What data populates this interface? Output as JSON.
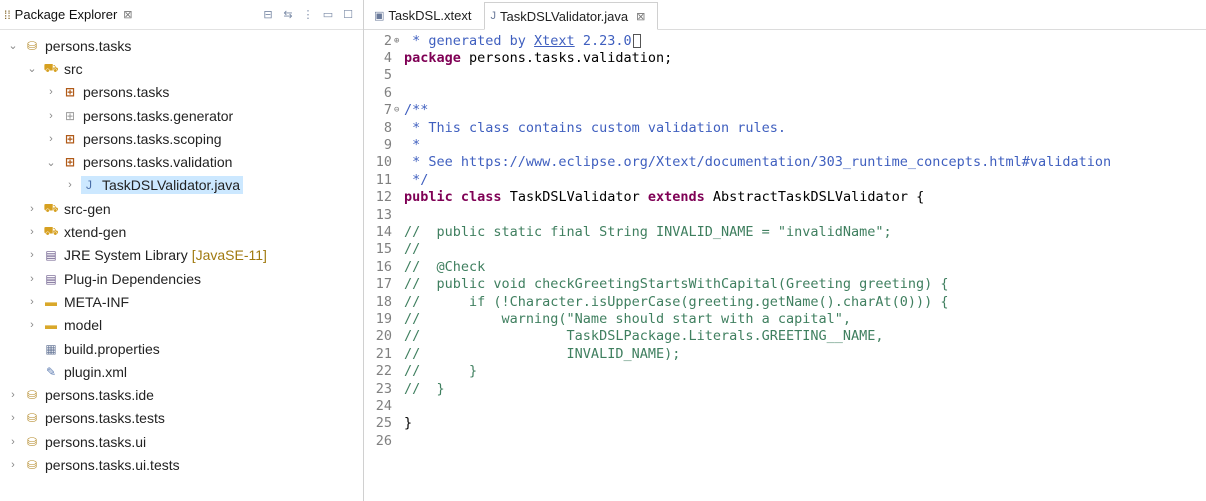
{
  "explorer": {
    "title": "Package Explorer",
    "close_glyph": "⊠",
    "toolbar": [
      "collapse-all-icon",
      "link-with-editor-icon",
      "view-menu-icon",
      "minimize-icon",
      "maximize-icon"
    ],
    "tree": [
      {
        "depth": 0,
        "twisty": "open",
        "icon": "project",
        "label": "persons.tasks"
      },
      {
        "depth": 1,
        "twisty": "open",
        "icon": "srcfolder",
        "label": "src"
      },
      {
        "depth": 2,
        "twisty": "closed",
        "icon": "package",
        "label": "persons.tasks"
      },
      {
        "depth": 2,
        "twisty": "closed",
        "icon": "emptypkg",
        "label": "persons.tasks.generator"
      },
      {
        "depth": 2,
        "twisty": "closed",
        "icon": "package",
        "label": "persons.tasks.scoping"
      },
      {
        "depth": 2,
        "twisty": "open",
        "icon": "package",
        "label": "persons.tasks.validation"
      },
      {
        "depth": 3,
        "twisty": "closed",
        "icon": "java",
        "label": "TaskDSLValidator.java",
        "selected": true
      },
      {
        "depth": 1,
        "twisty": "closed",
        "icon": "srcfolder",
        "label": "src-gen"
      },
      {
        "depth": 1,
        "twisty": "closed",
        "icon": "srcfolder",
        "label": "xtend-gen"
      },
      {
        "depth": 1,
        "twisty": "closed",
        "icon": "lib",
        "label": "JRE System Library",
        "decoration": "[JavaSE-11]"
      },
      {
        "depth": 1,
        "twisty": "closed",
        "icon": "lib",
        "label": "Plug-in Dependencies"
      },
      {
        "depth": 1,
        "twisty": "closed",
        "icon": "folder",
        "label": "META-INF"
      },
      {
        "depth": 1,
        "twisty": "closed",
        "icon": "folder",
        "label": "model"
      },
      {
        "depth": 1,
        "twisty": "none",
        "icon": "props",
        "label": "build.properties"
      },
      {
        "depth": 1,
        "twisty": "none",
        "icon": "xml",
        "label": "plugin.xml"
      },
      {
        "depth": 0,
        "twisty": "closed",
        "icon": "project",
        "label": "persons.tasks.ide"
      },
      {
        "depth": 0,
        "twisty": "closed",
        "icon": "project",
        "label": "persons.tasks.tests"
      },
      {
        "depth": 0,
        "twisty": "closed",
        "icon": "project",
        "label": "persons.tasks.ui"
      },
      {
        "depth": 0,
        "twisty": "closed",
        "icon": "project",
        "label": "persons.tasks.ui.tests"
      }
    ]
  },
  "editor": {
    "tabs": [
      {
        "label": "TaskDSL.xtext",
        "icon": "xtext-file-icon",
        "active": false
      },
      {
        "label": "TaskDSLValidator.java",
        "icon": "java-file-icon",
        "active": true,
        "close_glyph": "⊠"
      }
    ],
    "lines": [
      {
        "n": "2",
        "fold": "⊕",
        "caret": true,
        "tokens": [
          {
            "t": " * generated by ",
            "c": "doc"
          },
          {
            "t": "Xtext",
            "c": "link"
          },
          {
            "t": " 2.23.0",
            "c": "doc"
          }
        ]
      },
      {
        "n": "4",
        "tokens": [
          {
            "t": "package",
            "c": "kw"
          },
          {
            "t": " persons.tasks.validation;",
            "c": "txt"
          }
        ]
      },
      {
        "n": "5",
        "tokens": []
      },
      {
        "n": "6",
        "tokens": []
      },
      {
        "n": "7",
        "fold": "⊖",
        "tokens": [
          {
            "t": "/**",
            "c": "doc"
          }
        ]
      },
      {
        "n": "8",
        "tokens": [
          {
            "t": " * This class contains custom validation rules.",
            "c": "doc"
          }
        ]
      },
      {
        "n": "9",
        "tokens": [
          {
            "t": " *",
            "c": "doc"
          }
        ]
      },
      {
        "n": "10",
        "tokens": [
          {
            "t": " * See https://www.eclipse.org/Xtext/documentation/303_runtime_concepts.html#validation",
            "c": "doc"
          }
        ]
      },
      {
        "n": "11",
        "tokens": [
          {
            "t": " */",
            "c": "doc"
          }
        ]
      },
      {
        "n": "12",
        "tokens": [
          {
            "t": "public",
            "c": "kw"
          },
          {
            "t": " ",
            "c": "txt"
          },
          {
            "t": "class",
            "c": "kw"
          },
          {
            "t": " TaskDSLValidator ",
            "c": "txt"
          },
          {
            "t": "extends",
            "c": "kw"
          },
          {
            "t": " AbstractTaskDSLValidator {",
            "c": "txt"
          }
        ]
      },
      {
        "n": "13",
        "tokens": []
      },
      {
        "n": "14",
        "tokens": [
          {
            "t": "//  public static final String INVALID_NAME = \"invalidName\";",
            "c": "com"
          }
        ]
      },
      {
        "n": "15",
        "tokens": [
          {
            "t": "//",
            "c": "com"
          }
        ]
      },
      {
        "n": "16",
        "tokens": [
          {
            "t": "//  @Check",
            "c": "com"
          }
        ]
      },
      {
        "n": "17",
        "tokens": [
          {
            "t": "//  public void checkGreetingStartsWithCapital(Greeting greeting) {",
            "c": "com"
          }
        ]
      },
      {
        "n": "18",
        "tokens": [
          {
            "t": "//      if (!Character.isUpperCase(greeting.getName().charAt(0))) {",
            "c": "com"
          }
        ]
      },
      {
        "n": "19",
        "tokens": [
          {
            "t": "//          warning(\"Name should start with a capital\",",
            "c": "com"
          }
        ]
      },
      {
        "n": "20",
        "tokens": [
          {
            "t": "//                  TaskDSLPackage.Literals.GREETING__NAME,",
            "c": "com"
          }
        ]
      },
      {
        "n": "21",
        "tokens": [
          {
            "t": "//                  INVALID_NAME);",
            "c": "com"
          }
        ]
      },
      {
        "n": "22",
        "tokens": [
          {
            "t": "//      }",
            "c": "com"
          }
        ]
      },
      {
        "n": "23",
        "tokens": [
          {
            "t": "//  }",
            "c": "com"
          }
        ]
      },
      {
        "n": "24",
        "tokens": []
      },
      {
        "n": "25",
        "tokens": [
          {
            "t": "}",
            "c": "txt"
          }
        ]
      },
      {
        "n": "26",
        "tokens": []
      }
    ]
  }
}
